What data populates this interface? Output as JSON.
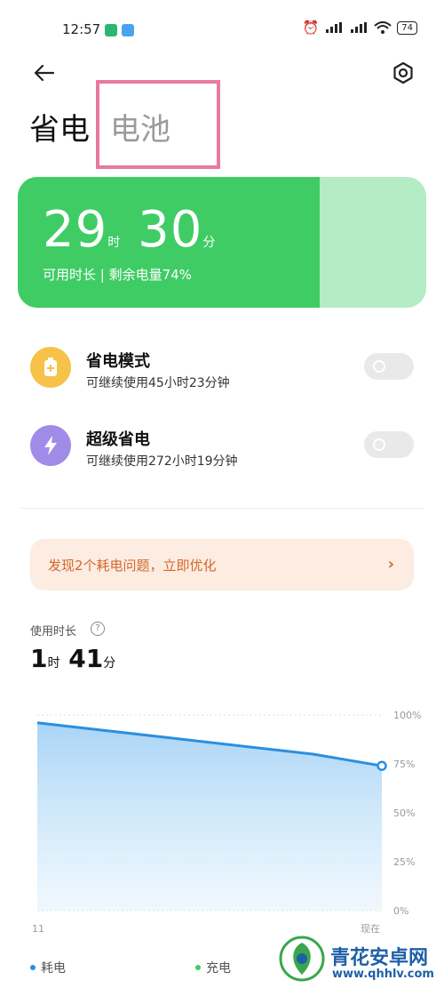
{
  "status_bar": {
    "time": "12:57",
    "battery_level": "74"
  },
  "header": {
    "tab_saving": "省电",
    "tab_battery": "电池"
  },
  "battery_card": {
    "hours": "29",
    "hour_unit": "时",
    "minutes": "30",
    "minute_unit": "分",
    "subtitle": "可用时长 | 剩余电量74%",
    "remaining_fraction": 0.74
  },
  "modes": [
    {
      "title": "省电模式",
      "subtitle": "可继续使用45小时23分钟",
      "enabled": false,
      "color": "#f7c24a"
    },
    {
      "title": "超级省电",
      "subtitle": "可继续使用272小时19分钟",
      "enabled": false,
      "color": "#a08be8"
    }
  ],
  "issue_banner": {
    "text": "发现2个耗电问题，立即优化",
    "chevron": "›"
  },
  "usage": {
    "label": "使用时长",
    "help": "?",
    "hours": "1",
    "hour_unit": "时",
    "minutes": "41",
    "minute_unit": "分"
  },
  "chart_data": {
    "type": "area",
    "x_labels": [
      "11",
      "现在"
    ],
    "y_ticks": [
      "100%",
      "75%",
      "50%",
      "25%",
      "0%"
    ],
    "ylim": [
      0,
      100
    ],
    "x": [
      0,
      0.2,
      0.4,
      0.6,
      0.8,
      1.0
    ],
    "values": [
      96,
      92,
      88,
      84,
      80,
      74
    ],
    "line_color": "#2b8fe0"
  },
  "legend": {
    "consumption": "耗电",
    "charging": "充电",
    "consumption_color": "#2b8fe0",
    "charging_color": "#3fcc65"
  },
  "watermark": {
    "title": "青花安卓网",
    "url": "www.qhhlv.com"
  }
}
